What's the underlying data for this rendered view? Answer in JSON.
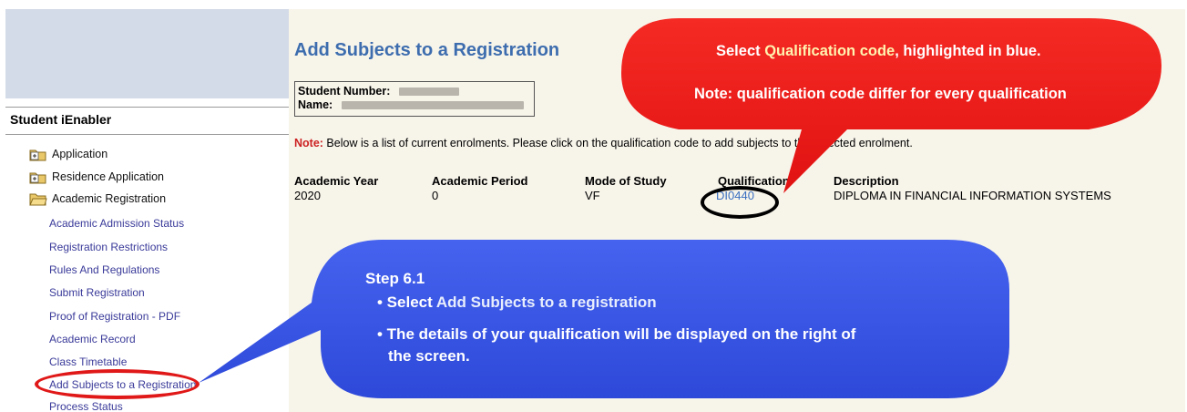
{
  "sidebar": {
    "title": "Student iEnabler",
    "folders": [
      {
        "label": "Application"
      },
      {
        "label": "Residence Application"
      },
      {
        "label": "Academic Registration"
      }
    ],
    "links": [
      {
        "label": "Academic Admission Status"
      },
      {
        "label": "Registration Restrictions"
      },
      {
        "label": "Rules And Regulations"
      },
      {
        "label": "Submit Registration"
      },
      {
        "label": "Proof of Registration - PDF"
      },
      {
        "label": "Academic Record"
      },
      {
        "label": "Class Timetable"
      },
      {
        "label": "Add Subjects to a Registration"
      },
      {
        "label": "Process Status"
      }
    ]
  },
  "main": {
    "title": "Add Subjects to a Registration",
    "student_number_label": "Student Number:",
    "name_label": "Name:",
    "note_label": "Note:",
    "note_text": " Below is a list of current enrolments. Please click on the qualification code to add subjects to the selected enrolment.",
    "table": {
      "headers": [
        "Academic Year",
        "Academic Period",
        "Mode of Study",
        "Qualification",
        "Description"
      ],
      "row": {
        "academic_year": "2020",
        "academic_period": "0",
        "mode_of_study": "VF",
        "qualification": "DI0440",
        "description": "DIPLOMA IN FINANCIAL INFORMATION SYSTEMS"
      }
    }
  },
  "red_callout": {
    "line1_a": "Select ",
    "line1_b": "Qualification code",
    "line1_c": ", highlighted in blue.",
    "line2": "Note: qualification code differ for every qualification"
  },
  "blue_callout": {
    "step": "Step 6.1",
    "bullet1_a": "• Select ",
    "bullet1_b": "Add Subjects to a registration",
    "bullet2": "• The details of your qualification will be displayed on the right of",
    "bullet2_cont": "the screen."
  },
  "colors": {
    "title_blue": "#3d6dae",
    "link_blue": "#3a6fc0",
    "note_red": "#cc2222",
    "callout_red": "#f21a1a",
    "callout_blue": "#3a57e6",
    "main_bg": "#f7f4ea"
  },
  "icons": {
    "folder": "folder-plus-icon"
  }
}
